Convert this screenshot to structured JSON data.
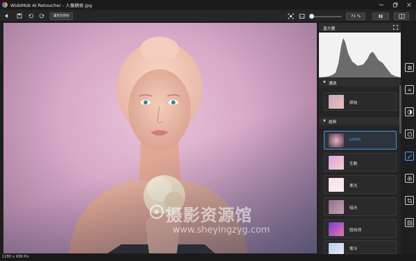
{
  "window": {
    "title": "WidsMob AI Retoucher - 人像精修.jpg"
  },
  "toolbar": {
    "restore_label": "還原為原始",
    "zoom_value": "71 %",
    "zoom_level": 0.05
  },
  "canvas": {
    "watermark_main": "摄影资源馆",
    "watermark_sub": "www.sheyingzyg.com"
  },
  "status": {
    "dimensions": "1280 x 938 Pix"
  },
  "panel": {
    "histogram_title": "直方圖",
    "sections": [
      {
        "label": "通過",
        "presets": [
          {
            "label": "原始"
          }
        ]
      },
      {
        "label": "經典",
        "presets": [
          {
            "label": "Lomo"
          },
          {
            "label": "生動"
          },
          {
            "label": "柔光"
          },
          {
            "label": "暗光"
          },
          {
            "label": "超自然"
          },
          {
            "label": "寒冷"
          }
        ]
      }
    ],
    "selected_preset": "Lomo"
  },
  "colors": {
    "accent": "#4da3ff",
    "panel_bg": "#252525",
    "app_bg": "#1e1e1e"
  },
  "tools": [
    "adjust-icon",
    "ai-icon",
    "lens-icon",
    "face-icon",
    "brush-icon",
    "settings-icon",
    "crop-icon",
    "frame-icon"
  ]
}
